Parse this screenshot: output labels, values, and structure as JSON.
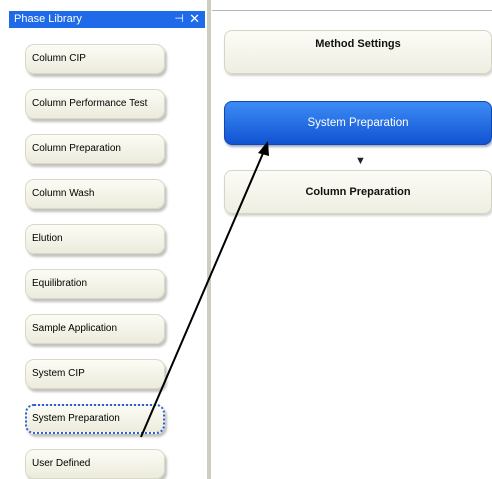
{
  "phase_library": {
    "title": "Phase Library",
    "pin_glyph": "⊣",
    "close_glyph": "✕",
    "phases": [
      {
        "label": "Column CIP"
      },
      {
        "label": "Column Performance Test"
      },
      {
        "label": "Column Preparation"
      },
      {
        "label": "Column Wash"
      },
      {
        "label": "Elution"
      },
      {
        "label": "Equilibration"
      },
      {
        "label": "Sample Application"
      },
      {
        "label": "System CIP"
      },
      {
        "label": "System Preparation"
      },
      {
        "label": "User Defined"
      }
    ]
  },
  "method": {
    "steps": [
      {
        "label": "Method Settings"
      },
      {
        "label": "System Preparation"
      },
      {
        "label": "Column Preparation"
      }
    ],
    "flow_arrow": "▼"
  },
  "colors": {
    "header": "#1f6ae8",
    "selected_step": "#1f6ae8"
  }
}
